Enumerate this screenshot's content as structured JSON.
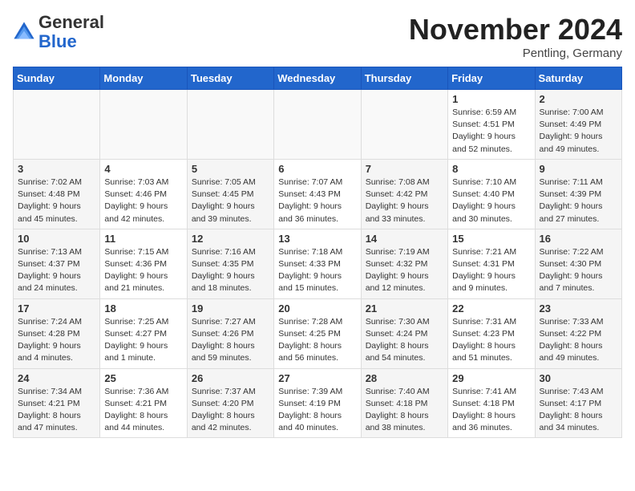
{
  "header": {
    "logo_general": "General",
    "logo_blue": "Blue",
    "month_title": "November 2024",
    "location": "Pentling, Germany"
  },
  "weekdays": [
    "Sunday",
    "Monday",
    "Tuesday",
    "Wednesday",
    "Thursday",
    "Friday",
    "Saturday"
  ],
  "weeks": [
    [
      {
        "day": "",
        "info": ""
      },
      {
        "day": "",
        "info": ""
      },
      {
        "day": "",
        "info": ""
      },
      {
        "day": "",
        "info": ""
      },
      {
        "day": "",
        "info": ""
      },
      {
        "day": "1",
        "info": "Sunrise: 6:59 AM\nSunset: 4:51 PM\nDaylight: 9 hours\nand 52 minutes."
      },
      {
        "day": "2",
        "info": "Sunrise: 7:00 AM\nSunset: 4:49 PM\nDaylight: 9 hours\nand 49 minutes."
      }
    ],
    [
      {
        "day": "3",
        "info": "Sunrise: 7:02 AM\nSunset: 4:48 PM\nDaylight: 9 hours\nand 45 minutes."
      },
      {
        "day": "4",
        "info": "Sunrise: 7:03 AM\nSunset: 4:46 PM\nDaylight: 9 hours\nand 42 minutes."
      },
      {
        "day": "5",
        "info": "Sunrise: 7:05 AM\nSunset: 4:45 PM\nDaylight: 9 hours\nand 39 minutes."
      },
      {
        "day": "6",
        "info": "Sunrise: 7:07 AM\nSunset: 4:43 PM\nDaylight: 9 hours\nand 36 minutes."
      },
      {
        "day": "7",
        "info": "Sunrise: 7:08 AM\nSunset: 4:42 PM\nDaylight: 9 hours\nand 33 minutes."
      },
      {
        "day": "8",
        "info": "Sunrise: 7:10 AM\nSunset: 4:40 PM\nDaylight: 9 hours\nand 30 minutes."
      },
      {
        "day": "9",
        "info": "Sunrise: 7:11 AM\nSunset: 4:39 PM\nDaylight: 9 hours\nand 27 minutes."
      }
    ],
    [
      {
        "day": "10",
        "info": "Sunrise: 7:13 AM\nSunset: 4:37 PM\nDaylight: 9 hours\nand 24 minutes."
      },
      {
        "day": "11",
        "info": "Sunrise: 7:15 AM\nSunset: 4:36 PM\nDaylight: 9 hours\nand 21 minutes."
      },
      {
        "day": "12",
        "info": "Sunrise: 7:16 AM\nSunset: 4:35 PM\nDaylight: 9 hours\nand 18 minutes."
      },
      {
        "day": "13",
        "info": "Sunrise: 7:18 AM\nSunset: 4:33 PM\nDaylight: 9 hours\nand 15 minutes."
      },
      {
        "day": "14",
        "info": "Sunrise: 7:19 AM\nSunset: 4:32 PM\nDaylight: 9 hours\nand 12 minutes."
      },
      {
        "day": "15",
        "info": "Sunrise: 7:21 AM\nSunset: 4:31 PM\nDaylight: 9 hours\nand 9 minutes."
      },
      {
        "day": "16",
        "info": "Sunrise: 7:22 AM\nSunset: 4:30 PM\nDaylight: 9 hours\nand 7 minutes."
      }
    ],
    [
      {
        "day": "17",
        "info": "Sunrise: 7:24 AM\nSunset: 4:28 PM\nDaylight: 9 hours\nand 4 minutes."
      },
      {
        "day": "18",
        "info": "Sunrise: 7:25 AM\nSunset: 4:27 PM\nDaylight: 9 hours\nand 1 minute."
      },
      {
        "day": "19",
        "info": "Sunrise: 7:27 AM\nSunset: 4:26 PM\nDaylight: 8 hours\nand 59 minutes."
      },
      {
        "day": "20",
        "info": "Sunrise: 7:28 AM\nSunset: 4:25 PM\nDaylight: 8 hours\nand 56 minutes."
      },
      {
        "day": "21",
        "info": "Sunrise: 7:30 AM\nSunset: 4:24 PM\nDaylight: 8 hours\nand 54 minutes."
      },
      {
        "day": "22",
        "info": "Sunrise: 7:31 AM\nSunset: 4:23 PM\nDaylight: 8 hours\nand 51 minutes."
      },
      {
        "day": "23",
        "info": "Sunrise: 7:33 AM\nSunset: 4:22 PM\nDaylight: 8 hours\nand 49 minutes."
      }
    ],
    [
      {
        "day": "24",
        "info": "Sunrise: 7:34 AM\nSunset: 4:21 PM\nDaylight: 8 hours\nand 47 minutes."
      },
      {
        "day": "25",
        "info": "Sunrise: 7:36 AM\nSunset: 4:21 PM\nDaylight: 8 hours\nand 44 minutes."
      },
      {
        "day": "26",
        "info": "Sunrise: 7:37 AM\nSunset: 4:20 PM\nDaylight: 8 hours\nand 42 minutes."
      },
      {
        "day": "27",
        "info": "Sunrise: 7:39 AM\nSunset: 4:19 PM\nDaylight: 8 hours\nand 40 minutes."
      },
      {
        "day": "28",
        "info": "Sunrise: 7:40 AM\nSunset: 4:18 PM\nDaylight: 8 hours\nand 38 minutes."
      },
      {
        "day": "29",
        "info": "Sunrise: 7:41 AM\nSunset: 4:18 PM\nDaylight: 8 hours\nand 36 minutes."
      },
      {
        "day": "30",
        "info": "Sunrise: 7:43 AM\nSunset: 4:17 PM\nDaylight: 8 hours\nand 34 minutes."
      }
    ]
  ]
}
